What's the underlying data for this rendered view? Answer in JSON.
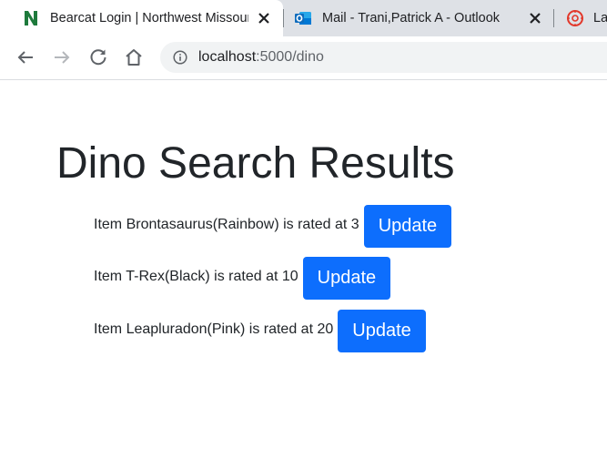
{
  "browser": {
    "tabs": [
      {
        "title": "Bearcat Login | Northwest Missouri State University",
        "favicon": "northwest-n-icon",
        "active": true
      },
      {
        "title": "Mail - Trani,Patrick A - Outlook",
        "favicon": "outlook-icon",
        "active": false
      },
      {
        "title": "La",
        "favicon": "canvas-icon",
        "active": false
      }
    ],
    "address": {
      "host": "localhost",
      "path": ":5000/dino"
    },
    "colors": {
      "tab_strip": "#dee1e6",
      "omnibox": "#f1f3f4",
      "northwest_green": "#1e7a3c",
      "outlook_blue": "#0f6cbd",
      "canvas_red": "#e2382b"
    }
  },
  "page": {
    "heading": "Dino Search Results",
    "items": [
      {
        "text": "Item Brontasaurus(Rainbow) is rated at 3",
        "button": "Update"
      },
      {
        "text": "Item T-Rex(Black) is rated at 10",
        "button": "Update"
      },
      {
        "text": "Item Leapluradon(Pink) is rated at 20",
        "button": "Update"
      }
    ],
    "colors": {
      "button": "#0d6efd",
      "button_text": "#ffffff",
      "text": "#212529"
    }
  }
}
